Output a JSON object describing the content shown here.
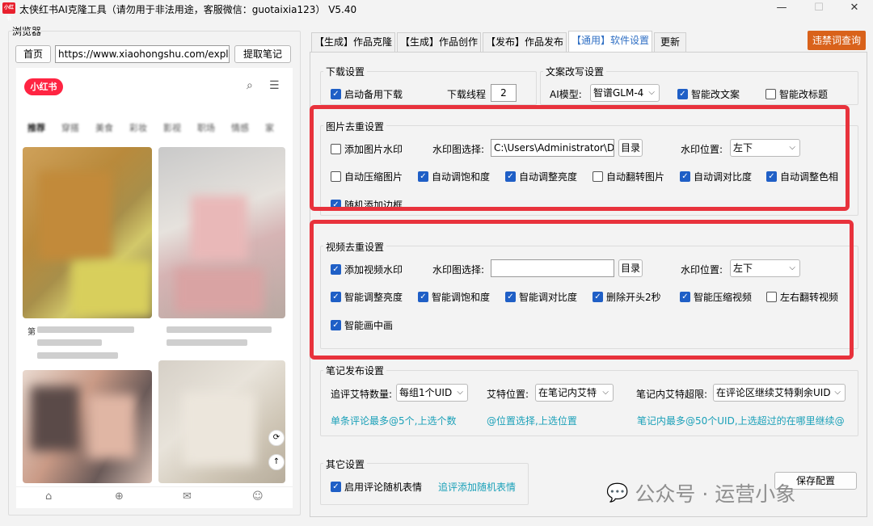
{
  "window": {
    "title": "太侠红书AI克隆工具（请勿用于非法用途，客服微信：guotaixia123） V5.40",
    "icon_text": "小红书"
  },
  "browser": {
    "group_label": "浏览器",
    "home_button": "首页",
    "url": "https://www.xiaohongshu.com/explor",
    "extract_button": "提取笔记",
    "logo": "小红书",
    "categories": [
      "推荐",
      "穿搭",
      "美食",
      "彩妆",
      "影视",
      "职场",
      "情感",
      "家"
    ],
    "card_prefix": "第"
  },
  "tabs": [
    "【生成】作品克隆",
    "【生成】作品创作",
    "【发布】作品发布",
    "【通用】软件设置",
    "更新"
  ],
  "banned_word_button": "违禁词查询",
  "download": {
    "group_label": "下载设置",
    "backup_download": "启动备用下载",
    "threads_label": "下载线程",
    "threads_value": "2"
  },
  "rewrite": {
    "group_label": "文案改写设置",
    "model_label": "AI模型:",
    "model_value": "智谱GLM-4",
    "smart_copy": "智能改文案",
    "smart_title": "智能改标题"
  },
  "image": {
    "group_label": "图片去重设置",
    "add_watermark": "添加图片水印",
    "watermark_select_label": "水印图选择:",
    "watermark_path": "C:\\Users\\Administrator\\De",
    "dir_button": "目录",
    "position_label": "水印位置:",
    "position_value": "左下",
    "options": [
      "自动压缩图片",
      "自动调饱和度",
      "自动调整亮度",
      "自动翻转图片",
      "自动调对比度",
      "自动调整色相"
    ],
    "random_border": "随机添加边框"
  },
  "video": {
    "group_label": "视频去重设置",
    "add_watermark": "添加视频水印",
    "watermark_select_label": "水印图选择:",
    "watermark_path": "",
    "dir_button": "目录",
    "position_label": "水印位置:",
    "position_value": "左下",
    "options": [
      "智能调整亮度",
      "智能调饱和度",
      "智能调对比度",
      "删除开头2秒",
      "智能压缩视频",
      "左右翻转视频"
    ],
    "pip": "智能画中画"
  },
  "publish": {
    "group_label": "笔记发布设置",
    "mention_count_label": "追评艾特数量:",
    "mention_count_value": "每组1个UID",
    "mention_pos_label": "艾特位置:",
    "mention_pos_value": "在笔记内艾特",
    "overflow_label": "笔记内艾特超限:",
    "overflow_value": "在评论区继续艾特剩余UID",
    "hint1": "单条评论最多@5个,上选个数",
    "hint2": "@位置选择,上选位置",
    "hint3": "笔记内最多@50个UID,上选超过的在哪里继续@"
  },
  "other": {
    "group_label": "其它设置",
    "random_emoji": "启用评论随机表情",
    "add_emoji_link": "追评添加随机表情",
    "save_button": "保存配置"
  },
  "watermark_overlay": "公众号 · 运营小象",
  "colors": {
    "accent": "#1f5fc6",
    "red_box": "#e8323c",
    "orange_button": "#d9621b",
    "hint": "#1aa0b8"
  }
}
